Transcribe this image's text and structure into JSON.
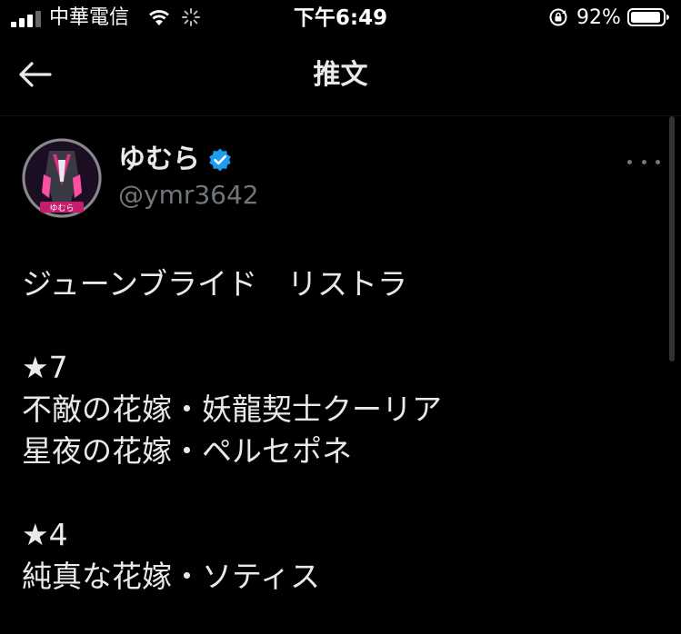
{
  "status_bar": {
    "carrier": "中華電信",
    "time": "下午6:49",
    "battery_percent": "92%"
  },
  "header": {
    "title": "推文"
  },
  "tweet": {
    "display_name": "ゆむら",
    "handle": "@ymr3642",
    "verified": true,
    "lines": [
      "ジューンブライド　リストラ",
      "",
      "★7",
      "不敵の花嫁・妖龍契士クーリア",
      "星夜の花嫁・ペルセポネ",
      "",
      "★4",
      "純真な花嫁・ソティス"
    ]
  },
  "colors": {
    "background": "#000000",
    "text": "#e7e9ea",
    "secondary_text": "#71767b",
    "verified_blue": "#1d9bf0"
  }
}
